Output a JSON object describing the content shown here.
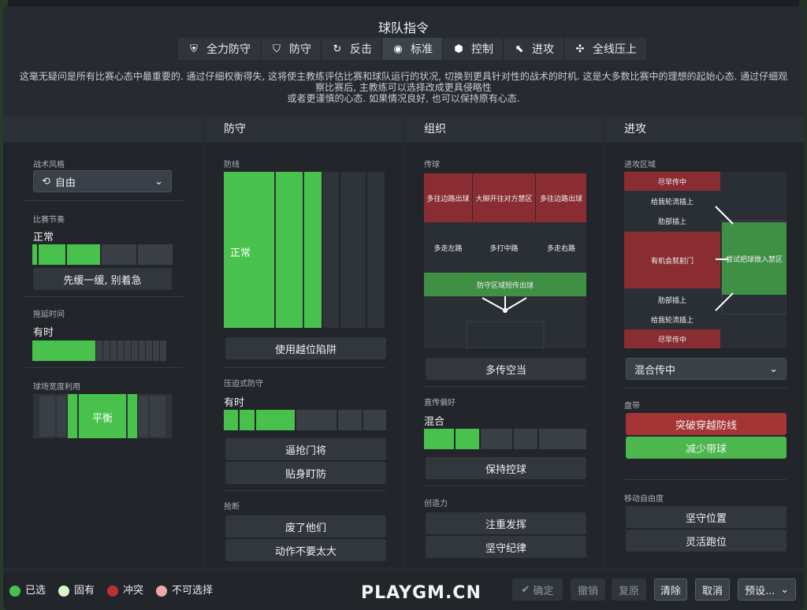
{
  "title": "球队指令",
  "tabs": [
    {
      "label": "全力防守",
      "icon": "shield-heart-icon"
    },
    {
      "label": "防守",
      "icon": "shield-icon"
    },
    {
      "label": "反击",
      "icon": "counter-icon"
    },
    {
      "label": "标准",
      "icon": "balance-icon"
    },
    {
      "label": "控制",
      "icon": "control-icon"
    },
    {
      "label": "进攻",
      "icon": "attack-arrow-icon"
    },
    {
      "label": "全线压上",
      "icon": "overload-icon"
    }
  ],
  "active_tab": "标准",
  "description": {
    "line1": "这毫无疑问是所有比赛心态中最重要的. 通过仔细权衡得失, 这将使主教练评估比赛和球队运行的状况, 切换到更具针对性的战术的时机. 这是大多数比赛中的理想的起始心态. 通过仔细观",
    "line2": "察比赛后, 主教练可以选择改成更具侵略性",
    "line3": "或者更谨慎的心态. 如果情况良好, 也可以保持原有心态."
  },
  "general": {
    "style_label": "战术风格",
    "style_value": "自由",
    "tempo_label": "比赛节奏",
    "tempo_value": "正常",
    "tempo_button": "先缓一缓, 别着急",
    "timewasting_label": "拖延时间",
    "timewasting_value": "有时",
    "width_label": "球场宽度利用",
    "width_value": "平衡"
  },
  "defence": {
    "header": "防守",
    "line_label": "防线",
    "line_value": "正常",
    "offside_button": "使用越位陷阱",
    "press_label": "压迫式防守",
    "press_value": "有时",
    "press_buttons": [
      "逼抢门将",
      "贴身盯防"
    ],
    "tackle_label": "抢断",
    "tackle_buttons": [
      "废了他们",
      "动作不要太大"
    ]
  },
  "organisation": {
    "header": "组织",
    "passing_label": "传球",
    "zones": {
      "top": [
        "多往边路出球",
        "大脚开往对方禁区",
        "多往边路出球"
      ],
      "mid": [
        "多走左路",
        "多打中路",
        "多走右路"
      ],
      "low": "防守区域短传出球"
    },
    "overlap_button": "多传空当",
    "directness_label": "直传偏好",
    "directness_value": "混合",
    "possession_button": "保持控球",
    "creativity_label": "创造力",
    "creativity_buttons": [
      "注重发挥",
      "坚守纪律"
    ]
  },
  "attack": {
    "header": "进攻",
    "zone_label": "进攻区域",
    "zones": {
      "cross_early_top": "尽早传中",
      "overlap_top": "给我轮流插上",
      "underlap_top": "肋部插上",
      "shoot": "有机会就射门",
      "work_into_box": "尝试把球做入禁区",
      "underlap_bottom": "肋部插上",
      "overlap_bottom": "给我轮流插上",
      "cross_early_bottom": "尽早传中"
    },
    "cross_select": "混合传中",
    "dribble_label": "盘带",
    "dribble_buttons": [
      "突破穿越防线",
      "减少带球"
    ],
    "freedom_label": "移动自由度",
    "freedom_buttons": [
      "坚守位置",
      "灵活跑位"
    ]
  },
  "legend": [
    {
      "label": "已选",
      "color": "#48c24c"
    },
    {
      "label": "固有",
      "color": "#d9f5c7"
    },
    {
      "label": "冲突",
      "color": "#b83235"
    },
    {
      "label": "不可选择",
      "color": "#f2a7a7"
    }
  ],
  "actions": {
    "confirm": "确定",
    "undo": "撤销",
    "restore": "复原",
    "clear": "清除",
    "cancel": "取消",
    "preset": "预设..."
  },
  "watermark": "PLAYGM.CN"
}
